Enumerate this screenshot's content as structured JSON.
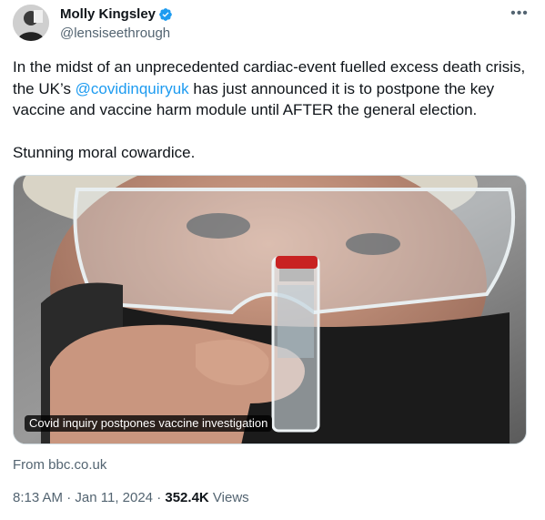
{
  "author": {
    "display_name": "Molly Kingsley",
    "handle": "@lensiseethrough",
    "verified_color": "#1d9bf0",
    "avatar_icon": "profile-photo"
  },
  "more_options_label": "•••",
  "tweet": {
    "text_part1": "In the midst of an unprecedented cardiac-event fuelled excess death crisis, the UK’s ",
    "mention": "@covidinquiryuk",
    "text_part2": " has just announced it is to postpone the key vaccine and vaccine harm module until AFTER the general election.",
    "text_part3": "Stunning moral cowardice."
  },
  "card": {
    "image_caption": "Covid inquiry postpones vaccine investigation",
    "source": "From bbc.co.uk"
  },
  "meta": {
    "time": "8:13 AM",
    "date": "Jan 11, 2024",
    "separator": "·",
    "views_count": "352.4K",
    "views_label": "Views"
  },
  "colors": {
    "text_primary": "#0f1419",
    "text_secondary": "#536471",
    "link": "#1d9bf0"
  }
}
